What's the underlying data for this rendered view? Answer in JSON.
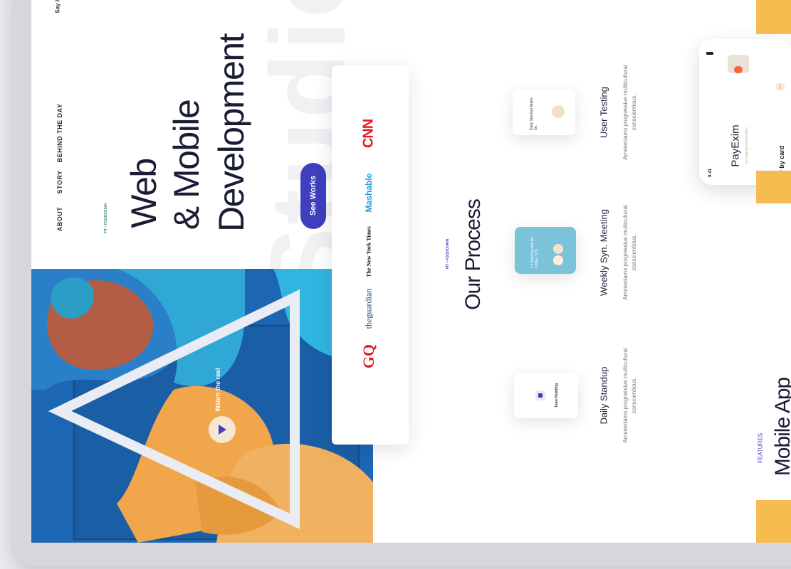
{
  "header": {
    "tagline_fragment": "Say h"
  },
  "nav": {
    "items": [
      "ABOUT",
      "STORY",
      "BEHIND THE DAY"
    ]
  },
  "hero": {
    "eyebrow": "FIT • FOODCHAIN",
    "line1": "Web",
    "line2": "& Mobile",
    "line3": "Development",
    "background_word": "Studio",
    "cta_label": "See Works",
    "mural_caption": "Watch the reel"
  },
  "press_logos": [
    "GQ",
    "theguardian",
    "The New York Times",
    "Mashable",
    "CNN"
  ],
  "process": {
    "eyebrow": "FIT • FOODCHAIN",
    "title": "Our Process",
    "steps": [
      {
        "title": "Daily Standup",
        "desc": "Amsterdams progressive multicultural conscientious.",
        "card_label": "Team Building"
      },
      {
        "title": "Weekly Syn. Meeting",
        "desc": "Amsterdams progressive multicultural conscientious.",
        "card_label": "1:1 Meeting with Mr. Zordan Smt"
      },
      {
        "title": "User Testing",
        "desc": "Amsterdams progressive multicultural conscientious.",
        "card_label": "Daily Standup Notes for.."
      }
    ]
  },
  "features": {
    "eyebrow": "FEATURES",
    "title": "Mobile App"
  },
  "phone": {
    "time": "9:41",
    "app_name": "PayExim",
    "subtitle": "Your daily transaction partner",
    "pay_label": "Pay by card",
    "chip": "Ad Nu"
  },
  "colors": {
    "accent": "#3f3fbf",
    "dark_text": "#1b1d35",
    "yellow": "#f6bc4f",
    "cnn_red": "#e11d2a",
    "mashable_blue": "#1a9fe0",
    "mural_blue": "#1d66b4"
  }
}
